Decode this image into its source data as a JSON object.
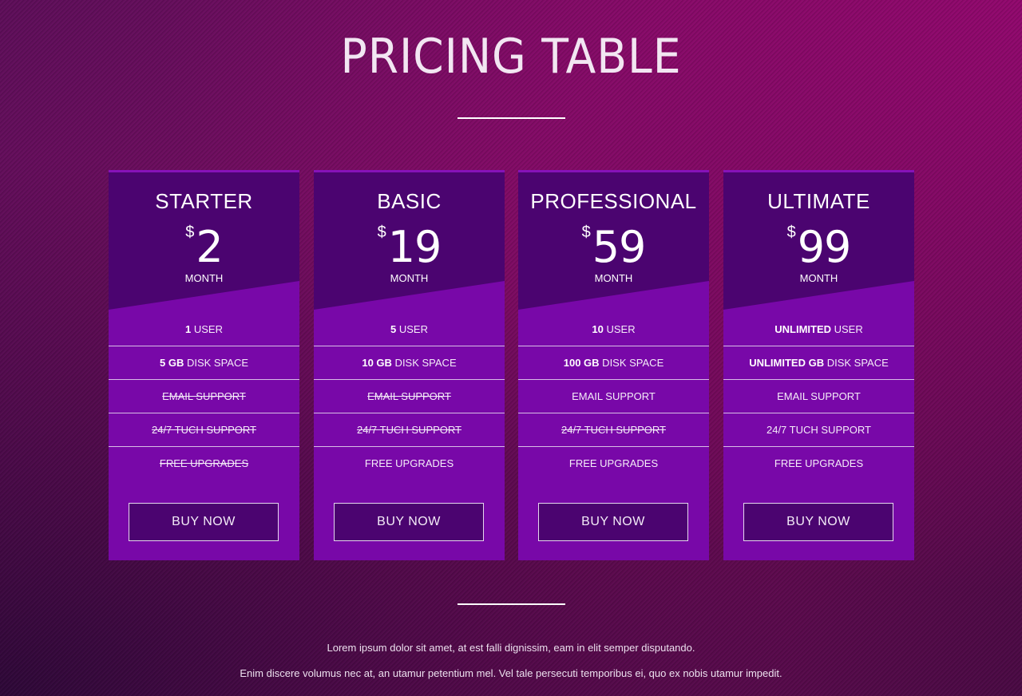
{
  "page": {
    "title": "PRICING TABLE"
  },
  "plans": [
    {
      "name": "STARTER",
      "currency": "$",
      "amount": "2",
      "period": "MONTH",
      "features": [
        {
          "strong": "1",
          "text": " USER",
          "enabled": true
        },
        {
          "strong": "5 GB",
          "text": " DISK SPACE",
          "enabled": true
        },
        {
          "strong": "",
          "text": "EMAIL SUPPORT",
          "enabled": false
        },
        {
          "strong": "",
          "text": "24/7 TUCH SUPPORT",
          "enabled": false
        },
        {
          "strong": "",
          "text": "FREE UPGRADES",
          "enabled": false
        }
      ],
      "button_label": "BUY NOW"
    },
    {
      "name": "BASIC",
      "currency": "$",
      "amount": "19",
      "period": "MONTH",
      "features": [
        {
          "strong": "5",
          "text": " USER",
          "enabled": true
        },
        {
          "strong": "10 GB",
          "text": " DISK SPACE",
          "enabled": true
        },
        {
          "strong": "",
          "text": "EMAIL SUPPORT",
          "enabled": false
        },
        {
          "strong": "",
          "text": "24/7 TUCH SUPPORT",
          "enabled": false
        },
        {
          "strong": "",
          "text": "FREE UPGRADES",
          "enabled": true
        }
      ],
      "button_label": "BUY NOW"
    },
    {
      "name": "PROFESSIONAL",
      "currency": "$",
      "amount": "59",
      "period": "MONTH",
      "features": [
        {
          "strong": "10",
          "text": " USER",
          "enabled": true
        },
        {
          "strong": "100 GB",
          "text": " DISK SPACE",
          "enabled": true
        },
        {
          "strong": "",
          "text": "EMAIL SUPPORT",
          "enabled": true
        },
        {
          "strong": "",
          "text": "24/7 TUCH SUPPORT",
          "enabled": false
        },
        {
          "strong": "",
          "text": "FREE UPGRADES",
          "enabled": true
        }
      ],
      "button_label": "BUY NOW"
    },
    {
      "name": "ULTIMATE",
      "currency": "$",
      "amount": "99",
      "period": "MONTH",
      "features": [
        {
          "strong": "UNLIMITED",
          "text": " USER",
          "enabled": true
        },
        {
          "strong": "UNLIMITED GB",
          "text": " DISK SPACE",
          "enabled": true
        },
        {
          "strong": "",
          "text": "EMAIL SUPPORT",
          "enabled": true
        },
        {
          "strong": "",
          "text": "24/7 TUCH SUPPORT",
          "enabled": true
        },
        {
          "strong": "",
          "text": "FREE UPGRADES",
          "enabled": true
        }
      ],
      "button_label": "BUY NOW"
    }
  ],
  "footer": {
    "line1": "Lorem ipsum dolor sit amet, at est falli dignissim, eam in elit semper disputando.",
    "line2": "Enim discere volumus nec at, an utamur petentium mel. Vel tale persecuti temporibus ei, quo ex nobis utamur impedit."
  },
  "colors": {
    "card_body": "#7808a8",
    "card_header": "#4b0470",
    "button_bg": "#4b0470"
  }
}
